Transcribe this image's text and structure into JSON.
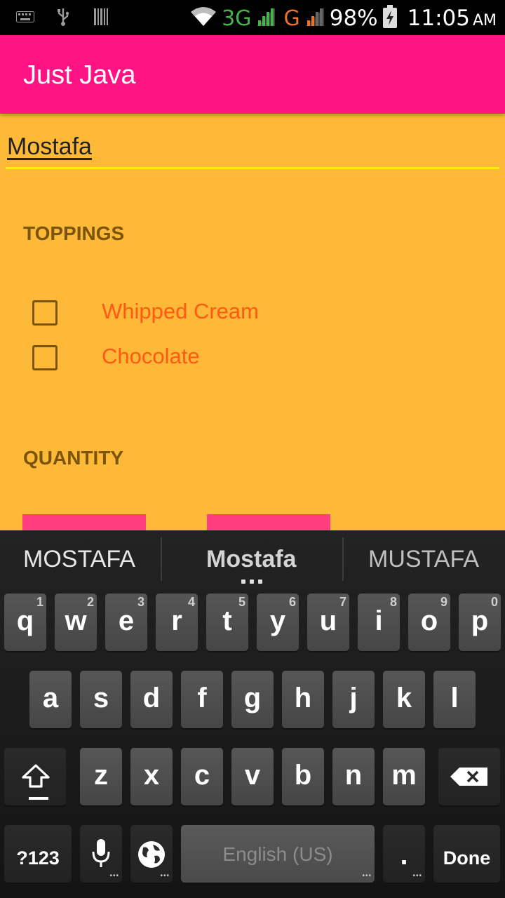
{
  "status_bar": {
    "left_icons": [
      "keyboard-icon",
      "usb-icon",
      "barcode-icon"
    ],
    "network_3g": "3G",
    "network_g": "G",
    "battery_percent": "98%",
    "time": "11:05",
    "ampm": "AM"
  },
  "app_bar": {
    "title": "Just Java"
  },
  "name_field": {
    "value": "Mostafa"
  },
  "toppings": {
    "header": "TOPPINGS",
    "options": [
      {
        "label": "Whipped Cream",
        "checked": false
      },
      {
        "label": "Chocolate",
        "checked": false
      }
    ]
  },
  "quantity": {
    "header": "QUANTITY"
  },
  "colors": {
    "background": "#FFB938",
    "app_bar": "#FF1284",
    "accent_underline": "#FFEE00",
    "topping_label": "#FF5A14",
    "section_header": "#7A5408",
    "button": "#FF3D7F"
  },
  "keyboard": {
    "suggestions": [
      "MOSTAFA",
      "Mostafa",
      "MUSTAFA"
    ],
    "row1": [
      {
        "ch": "q",
        "sub": "1"
      },
      {
        "ch": "w",
        "sub": "2"
      },
      {
        "ch": "e",
        "sub": "3"
      },
      {
        "ch": "r",
        "sub": "4"
      },
      {
        "ch": "t",
        "sub": "5"
      },
      {
        "ch": "y",
        "sub": "6"
      },
      {
        "ch": "u",
        "sub": "7"
      },
      {
        "ch": "i",
        "sub": "8"
      },
      {
        "ch": "o",
        "sub": "9"
      },
      {
        "ch": "p",
        "sub": "0"
      }
    ],
    "row2": [
      "a",
      "s",
      "d",
      "f",
      "g",
      "h",
      "j",
      "k",
      "l"
    ],
    "row3": [
      "z",
      "x",
      "c",
      "v",
      "b",
      "n",
      "m"
    ],
    "symbols_label": "?123",
    "space_label": "English (US)",
    "period_label": ".",
    "done_label": "Done"
  }
}
